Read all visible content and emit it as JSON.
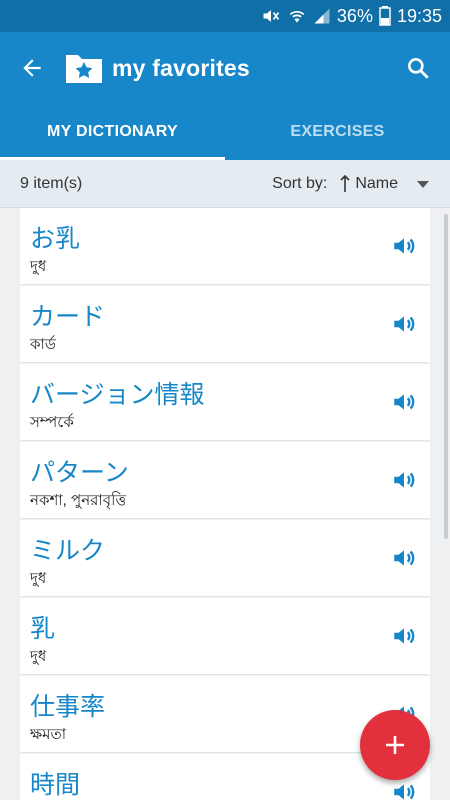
{
  "status": {
    "battery": "36%",
    "time": "19:35"
  },
  "appbar": {
    "title": "my favorites"
  },
  "tabs": [
    {
      "label": "MY DICTIONARY",
      "active": true
    },
    {
      "label": "EXERCISES",
      "active": false
    }
  ],
  "sort": {
    "count": "9 item(s)",
    "label": "Sort by:",
    "value": "Name"
  },
  "items": [
    {
      "jp": "お乳",
      "bn": "দুধ"
    },
    {
      "jp": "カード",
      "bn": "কার্ড"
    },
    {
      "jp": "バージョン情報",
      "bn": "সম্পর্কে"
    },
    {
      "jp": "パターン",
      "bn": "নকশা, পুনরাবৃত্তি"
    },
    {
      "jp": "ミルク",
      "bn": "দুধ"
    },
    {
      "jp": "乳",
      "bn": "দুধ"
    },
    {
      "jp": "仕事率",
      "bn": "ক্ষমতা"
    },
    {
      "jp": "時間",
      "bn": ""
    }
  ],
  "colors": {
    "primary": "#1787c9",
    "statusbar": "#0f6fa6",
    "fab": "#e2303d",
    "accent_text": "#1787c9"
  },
  "icons": {
    "back": "arrow-back-icon",
    "folder": "folder-star-icon",
    "search": "search-icon",
    "speaker": "speaker-icon",
    "fab": "plus-icon"
  }
}
